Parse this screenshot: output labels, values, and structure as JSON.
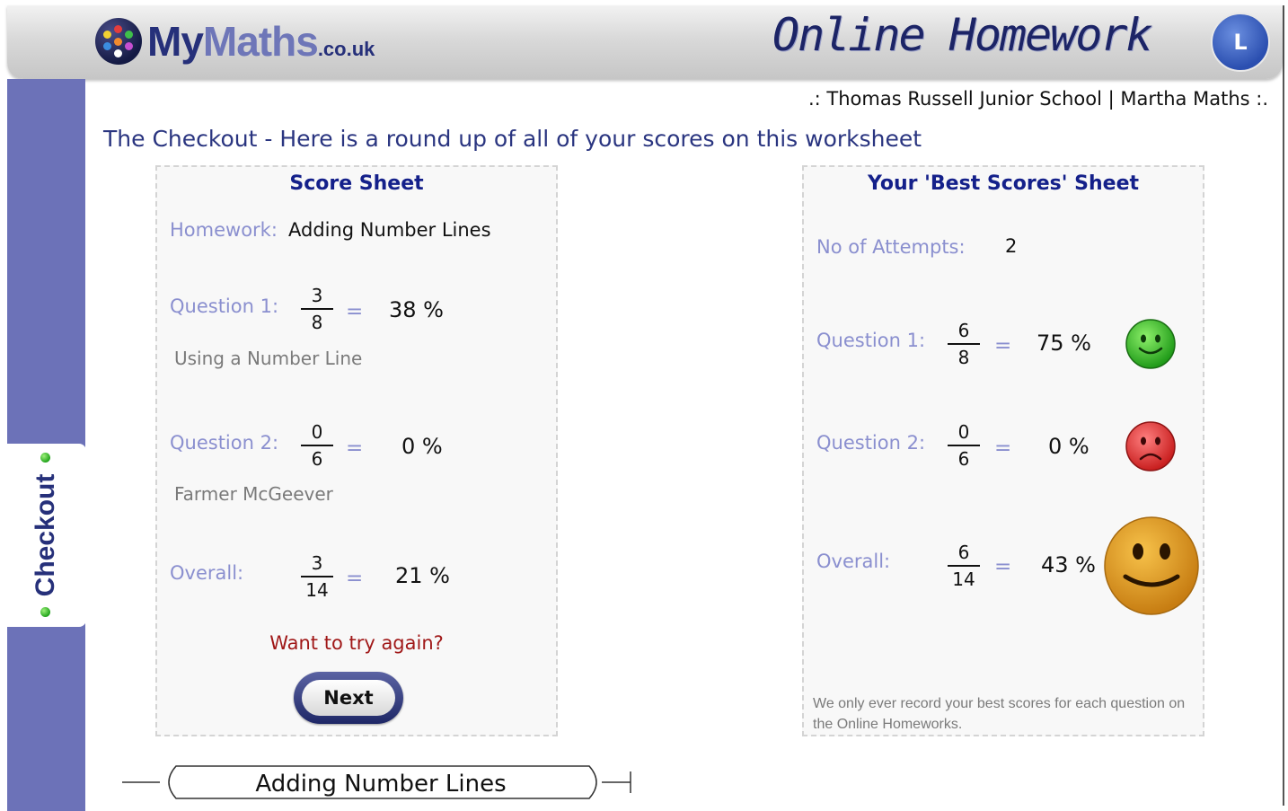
{
  "header": {
    "logo_my": "My",
    "logo_maths": "Maths",
    "logo_couk": ".co.uk",
    "banner": "Online Homework",
    "badge_letter": "L"
  },
  "sidebar": {
    "tab_label": "Checkout"
  },
  "school_line": ".: Thomas Russell Junior School | Martha Maths :.",
  "page_title": "The Checkout - Here is a round up of all of your scores on this worksheet",
  "score_sheet": {
    "title": "Score Sheet",
    "homework_label": "Homework:",
    "homework_value": "Adding Number Lines",
    "questions": [
      {
        "label": "Question 1:",
        "num": "3",
        "den": "8",
        "eq": "=",
        "pct": "38 %",
        "subtitle": "Using a Number Line"
      },
      {
        "label": "Question 2:",
        "num": "0",
        "den": "6",
        "eq": "=",
        "pct": "0 %",
        "subtitle": "Farmer McGeever"
      }
    ],
    "overall": {
      "label": "Overall:",
      "num": "3",
      "den": "14",
      "eq": "=",
      "pct": "21 %"
    },
    "again_text": "Want to try again?",
    "next_label": "Next"
  },
  "best_scores": {
    "title": "Your 'Best Scores' Sheet",
    "attempts_label": "No of Attempts:",
    "attempts_value": "2",
    "questions": [
      {
        "label": "Question 1:",
        "num": "6",
        "den": "8",
        "eq": "=",
        "pct": "75 %",
        "face": "happy-green"
      },
      {
        "label": "Question 2:",
        "num": "0",
        "den": "6",
        "eq": "=",
        "pct": "0 %",
        "face": "sad-red"
      }
    ],
    "overall": {
      "label": "Overall:",
      "num": "6",
      "den": "14",
      "eq": "=",
      "pct": "43 %",
      "face": "smile-orange"
    },
    "note": "We only ever record your best scores for each question on the Online Homeworks."
  },
  "footer": {
    "worksheet_title": "Adding Number Lines"
  },
  "colors": {
    "sidebar": "#6c72b8",
    "title_blue": "#2a3580",
    "label_lilac": "#8a8fcf",
    "again_red": "#a01818"
  }
}
